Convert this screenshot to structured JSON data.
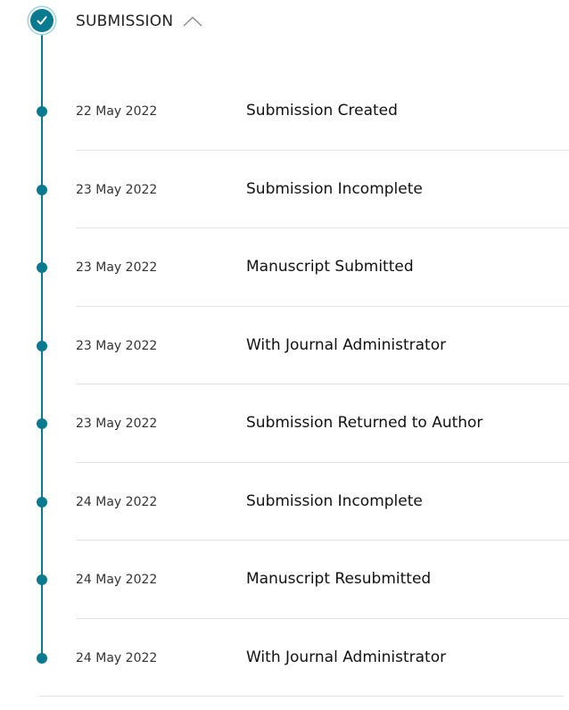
{
  "section": {
    "title": "SUBMISSION",
    "status_icon": "check-icon",
    "toggle_icon": "chevron-up-icon",
    "accent_color": "#0a7a91"
  },
  "events": [
    {
      "date": "22 May 2022",
      "status": "Submission Created"
    },
    {
      "date": "23 May 2022",
      "status": "Submission Incomplete"
    },
    {
      "date": "23 May 2022",
      "status": "Manuscript Submitted"
    },
    {
      "date": "23 May 2022",
      "status": "With Journal Administrator"
    },
    {
      "date": "23 May 2022",
      "status": "Submission Returned to Author"
    },
    {
      "date": "24 May 2022",
      "status": "Submission Incomplete"
    },
    {
      "date": "24 May 2022",
      "status": "Manuscript Resubmitted"
    },
    {
      "date": "24 May 2022",
      "status": "With Journal Administrator"
    }
  ]
}
